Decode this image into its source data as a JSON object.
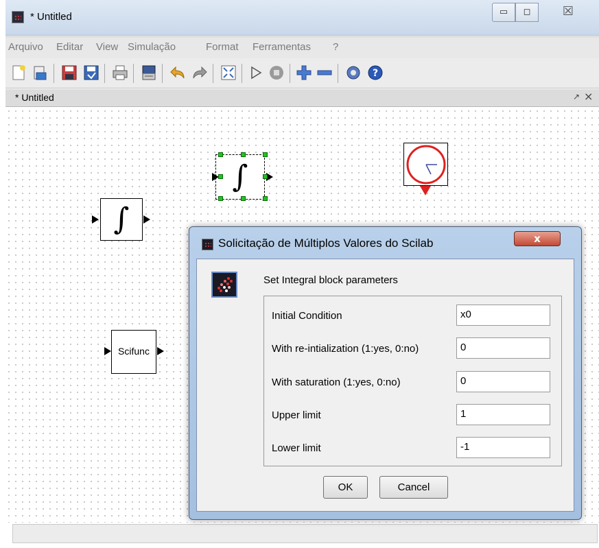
{
  "window": {
    "title": "* Untitled",
    "minimize_glyph": "▭",
    "maximize_glyph": "◻",
    "close_glyph": "☒"
  },
  "menu": [
    "Arquivo",
    "Editar",
    "View",
    "Simulação",
    "Format",
    "Ferramentas",
    "?"
  ],
  "toolbar_icons": [
    "new-diagram-icon",
    "open-icon",
    "save-icon",
    "save-as-icon",
    "print-icon",
    "export-icon",
    "undo-icon",
    "redo-icon",
    "fit-diagram-icon",
    "start-icon",
    "stop-icon",
    "zoom-in-icon",
    "zoom-out-icon",
    "setup-icon",
    "help-icon"
  ],
  "tab": {
    "title": "* Untitled",
    "undock_glyph": "↗",
    "close_glyph": "×"
  },
  "blocks": {
    "integral_symbol": "∫",
    "scifunc_label": "Scifunc"
  },
  "dialog": {
    "title": "Solicitação de Múltiplos Valores do Scilab",
    "close_glyph": "x",
    "heading": "Set Integral block parameters",
    "params": [
      {
        "label": "Initial Condition",
        "value": "x0"
      },
      {
        "label": "With re-intialization (1:yes, 0:no)",
        "value": "0"
      },
      {
        "label": "With saturation (1:yes, 0:no)",
        "value": "0"
      },
      {
        "label": "Upper limit",
        "value": "1"
      },
      {
        "label": "Lower limit",
        "value": "-1"
      }
    ],
    "ok_label": "OK",
    "cancel_label": "Cancel"
  },
  "colors": {
    "selection_handles": "#1fc41f",
    "clock_red": "#e02020",
    "dialog_frame": "#a4bfe0"
  }
}
